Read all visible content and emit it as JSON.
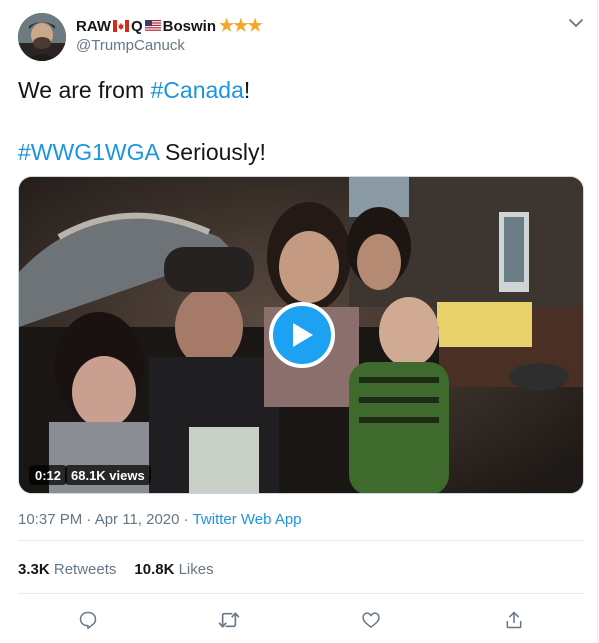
{
  "user": {
    "name_part1": "RAW",
    "name_part2": "Q",
    "name_part3": "Boswin",
    "stars": "★★★",
    "handle": "@TrumpCanuck"
  },
  "tweet": {
    "line1_text": "We are from ",
    "line1_hashtag": "#Canada",
    "line1_end": "!",
    "line2_hashtag": "#WWG1WGA",
    "line2_text": " Seriously!"
  },
  "video": {
    "duration": "0:12",
    "views": "68.1K views"
  },
  "meta": {
    "time": "10:37 PM · Apr 11, 2020 · ",
    "source": "Twitter Web App"
  },
  "stats": {
    "retweets_count": "3.3K",
    "retweets_label": " Retweets",
    "likes_count": "10.8K",
    "likes_label": " Likes"
  },
  "icons": [
    "avatar",
    "canada-flag-icon",
    "us-flag-icon",
    "star-icon",
    "chevron-down-icon",
    "play-icon",
    "reply-icon",
    "retweet-icon",
    "like-icon",
    "share-icon"
  ],
  "colors": {
    "accent": "#1b95e0",
    "play_button": "#1da1f2",
    "secondary_text": "#657786",
    "primary_text": "#14171a",
    "stars": "#f5a623"
  }
}
